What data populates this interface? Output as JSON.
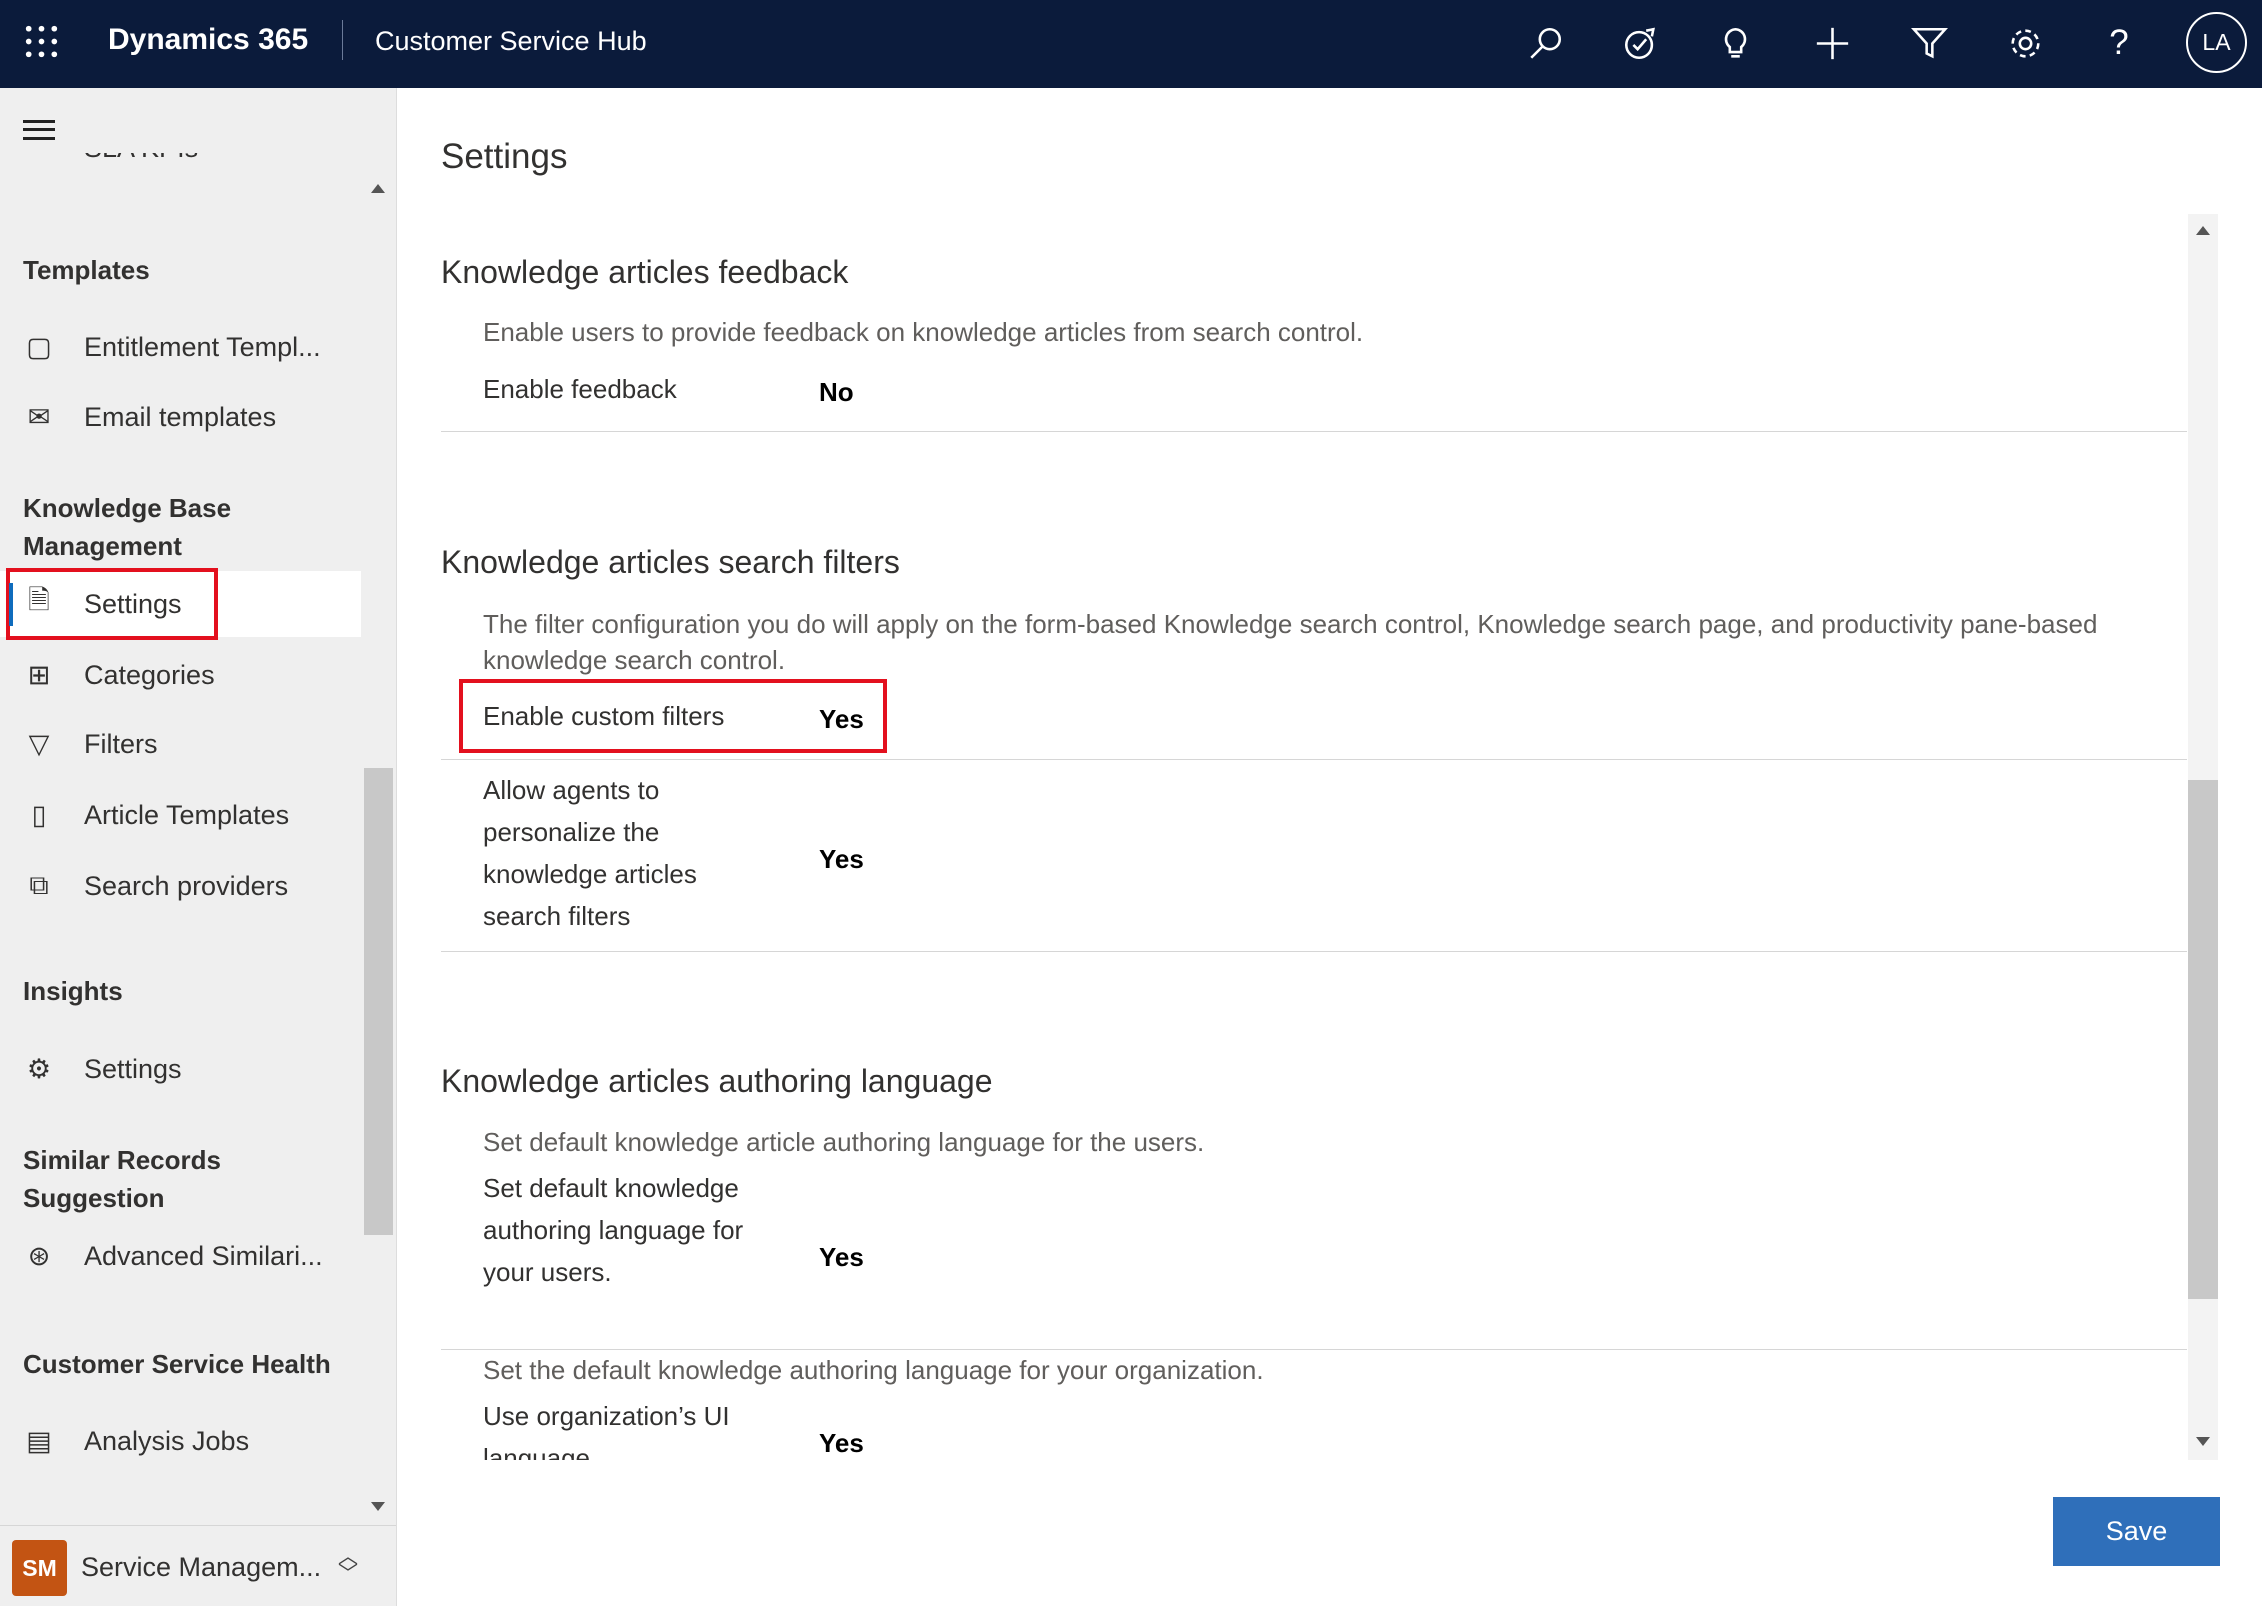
{
  "header": {
    "app": "Dynamics 365",
    "module": "Customer Service Hub",
    "avatar": "LA",
    "icons": [
      "search-icon",
      "assistant-icon",
      "lightbulb-icon",
      "new-icon",
      "filter-icon",
      "gear-icon",
      "help-icon"
    ]
  },
  "sidebar": {
    "cut_item": "SLA KPIs",
    "groups": [
      {
        "heading": "Templates",
        "items": [
          {
            "label": "Entitlement Templ..."
          },
          {
            "label": "Email templates"
          }
        ]
      },
      {
        "heading": "Knowledge Base Management",
        "items": [
          {
            "label": "Settings",
            "selected": true
          },
          {
            "label": "Categories"
          },
          {
            "label": "Filters"
          },
          {
            "label": "Article Templates"
          },
          {
            "label": "Search providers"
          }
        ]
      },
      {
        "heading": "Insights",
        "items": [
          {
            "label": "Settings"
          }
        ]
      },
      {
        "heading": "Similar Records Suggestion",
        "items": [
          {
            "label": "Advanced Similari..."
          }
        ]
      },
      {
        "heading": "Customer Service Health",
        "items": [
          {
            "label": "Analysis Jobs"
          }
        ]
      }
    ],
    "area": {
      "badge": "SM",
      "label": "Service Managem...",
      "badge_color": "#c35413"
    }
  },
  "main": {
    "title": "Settings",
    "sections": [
      {
        "title": "Knowledge articles feedback",
        "description": "Enable users to provide feedback on knowledge articles from search control.",
        "fields": [
          {
            "label": "Enable feedback",
            "value": "No"
          }
        ]
      },
      {
        "title": "Knowledge articles search filters",
        "description": "The filter configuration you do will apply on the form-based Knowledge search control, Knowledge search page, and productivity pane-based knowledge search control.",
        "fields": [
          {
            "label": "Enable custom filters",
            "value": "Yes"
          },
          {
            "label": "Allow agents to personalize the knowledge articles search filters",
            "value": "Yes"
          }
        ]
      },
      {
        "title": "Knowledge articles authoring language",
        "description": "Set default knowledge article authoring language for the users.",
        "fields": [
          {
            "label": "Set default knowledge authoring language for your users.",
            "value": "Yes"
          },
          {
            "description": "Set the default knowledge authoring language for your organization.",
            "label": "Use organization’s UI language",
            "value": "Yes"
          }
        ]
      }
    ],
    "save": "Save"
  }
}
